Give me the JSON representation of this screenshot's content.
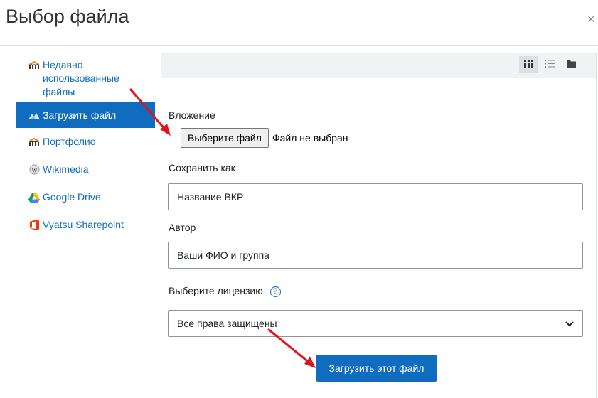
{
  "dialog": {
    "title": "Выбор файла",
    "close_label": "×"
  },
  "sidebar": {
    "items": [
      {
        "label": "Недавно использованные файлы",
        "icon": "moodle-icon",
        "active": false
      },
      {
        "label": "Загрузить файл",
        "icon": "upload-icon",
        "active": true
      },
      {
        "label": "Портфолио",
        "icon": "moodle-icon",
        "active": false
      },
      {
        "label": "Wikimedia",
        "icon": "wikimedia-icon",
        "active": false
      },
      {
        "label": "Google Drive",
        "icon": "google-drive-icon",
        "active": false
      },
      {
        "label": "Vyatsu Sharepoint",
        "icon": "office-icon",
        "active": false
      }
    ]
  },
  "toolbar": {
    "views": [
      {
        "icon": "grid-view-icon",
        "active": true
      },
      {
        "icon": "list-view-icon",
        "active": false
      },
      {
        "icon": "folder-view-icon",
        "active": false
      }
    ]
  },
  "form": {
    "attachment_label": "Вложение",
    "choose_file_button": "Выберите файл",
    "no_file_text": "Файл не выбран",
    "save_as_label": "Сохранить как",
    "save_as_value": "Название ВКР",
    "author_label": "Автор",
    "author_value": "Ваши ФИО и группа",
    "license_label": "Выберите лицензию",
    "license_help": "?",
    "license_value": "Все права защищены",
    "upload_button": "Загрузить этот файл"
  },
  "colors": {
    "accent": "#0f6cbf",
    "arrow": "#e0141a"
  }
}
